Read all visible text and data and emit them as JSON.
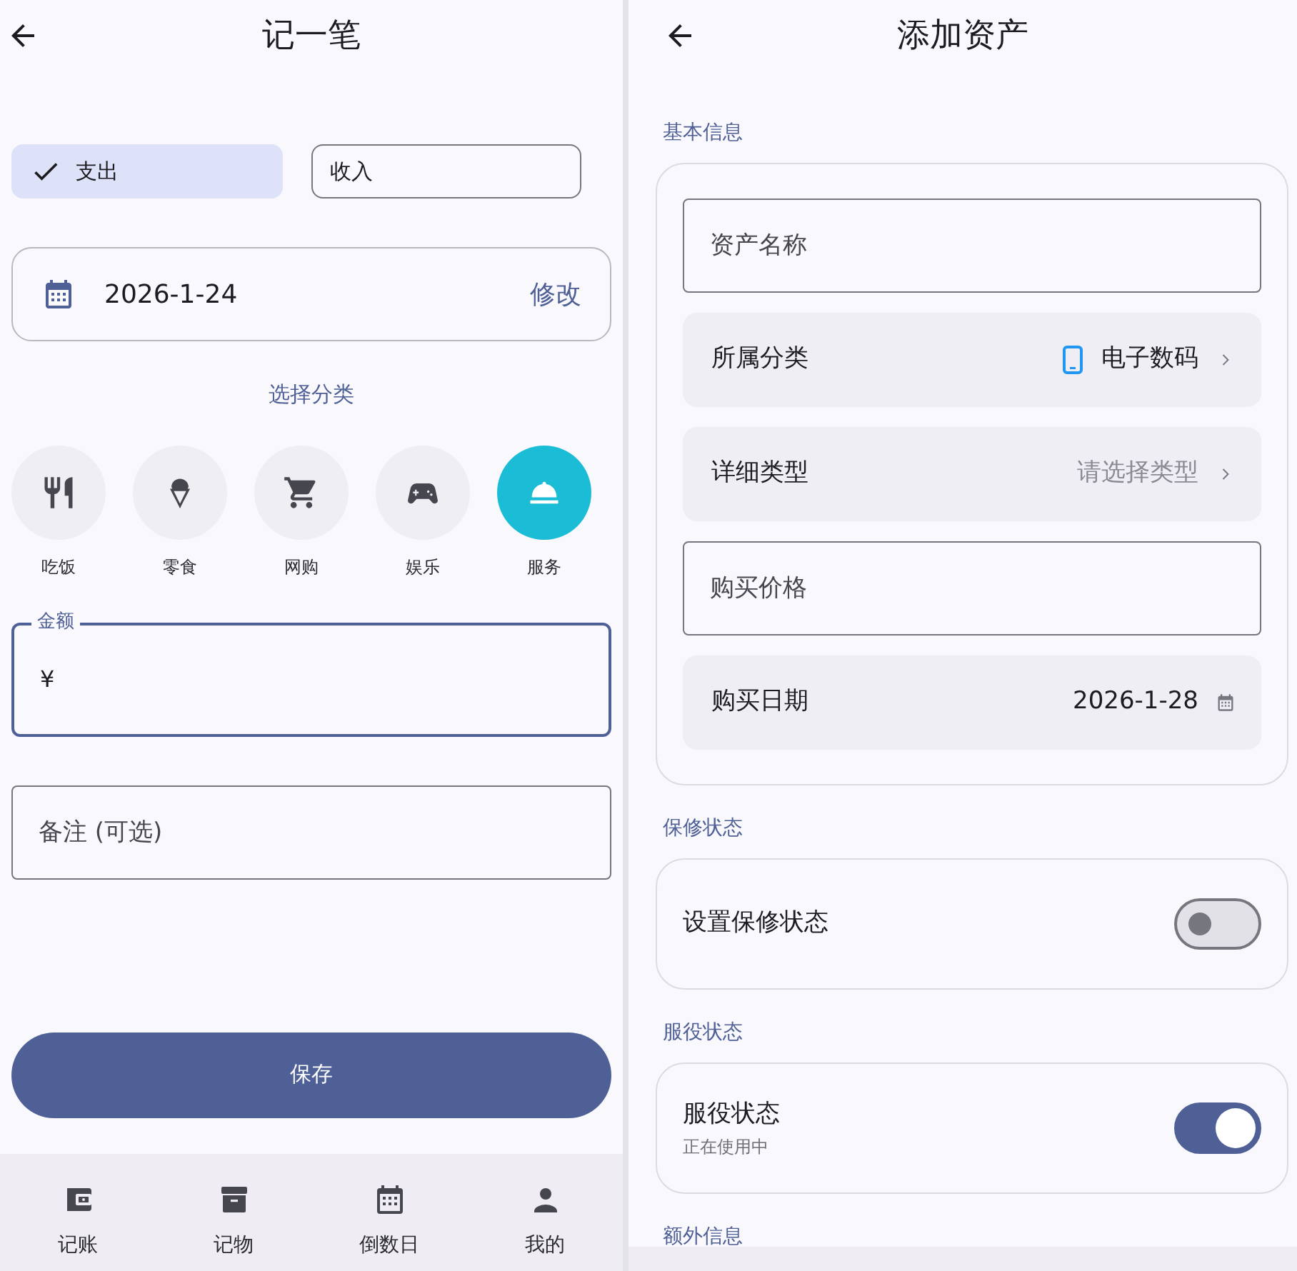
{
  "expense_screen": {
    "title": "记一笔",
    "type_tabs": [
      {
        "label": "支出",
        "selected": true
      },
      {
        "label": "收入",
        "selected": false
      }
    ],
    "date": {
      "value": "2026-1-24",
      "action": "修改"
    },
    "category_heading": "选择分类",
    "categories": [
      {
        "label": "吃饭",
        "selected": false
      },
      {
        "label": "零食",
        "selected": false
      },
      {
        "label": "网购",
        "selected": false
      },
      {
        "label": "娱乐",
        "selected": false
      },
      {
        "label": "服务",
        "selected": true
      }
    ],
    "amount": {
      "label": "金额",
      "prefix": "¥"
    },
    "note": {
      "placeholder": "备注 (可选)"
    },
    "save_button": "保存",
    "nav": [
      {
        "label": "记账"
      },
      {
        "label": "记物"
      },
      {
        "label": "倒数日"
      },
      {
        "label": "我的"
      }
    ]
  },
  "asset_screen": {
    "title": "添加资产",
    "sections": [
      {
        "heading": "基本信息",
        "rows": [
          {
            "kind": "input",
            "placeholder": "资产名称"
          },
          {
            "kind": "select",
            "label": "所属分类",
            "value": "电子数码"
          },
          {
            "kind": "select",
            "label": "详细类型",
            "placeholder": "请选择类型"
          },
          {
            "kind": "input",
            "placeholder": "购买价格"
          },
          {
            "kind": "date",
            "label": "购买日期",
            "value": "2026-1-28"
          }
        ]
      },
      {
        "heading": "保修状态",
        "rows": [
          {
            "kind": "switch",
            "label": "设置保修状态",
            "on": false
          }
        ]
      },
      {
        "heading": "服役状态",
        "rows": [
          {
            "kind": "switch",
            "label": "服役状态",
            "sublabel": "正在使用中",
            "on": true
          }
        ]
      },
      {
        "heading": "额外信息"
      }
    ]
  }
}
